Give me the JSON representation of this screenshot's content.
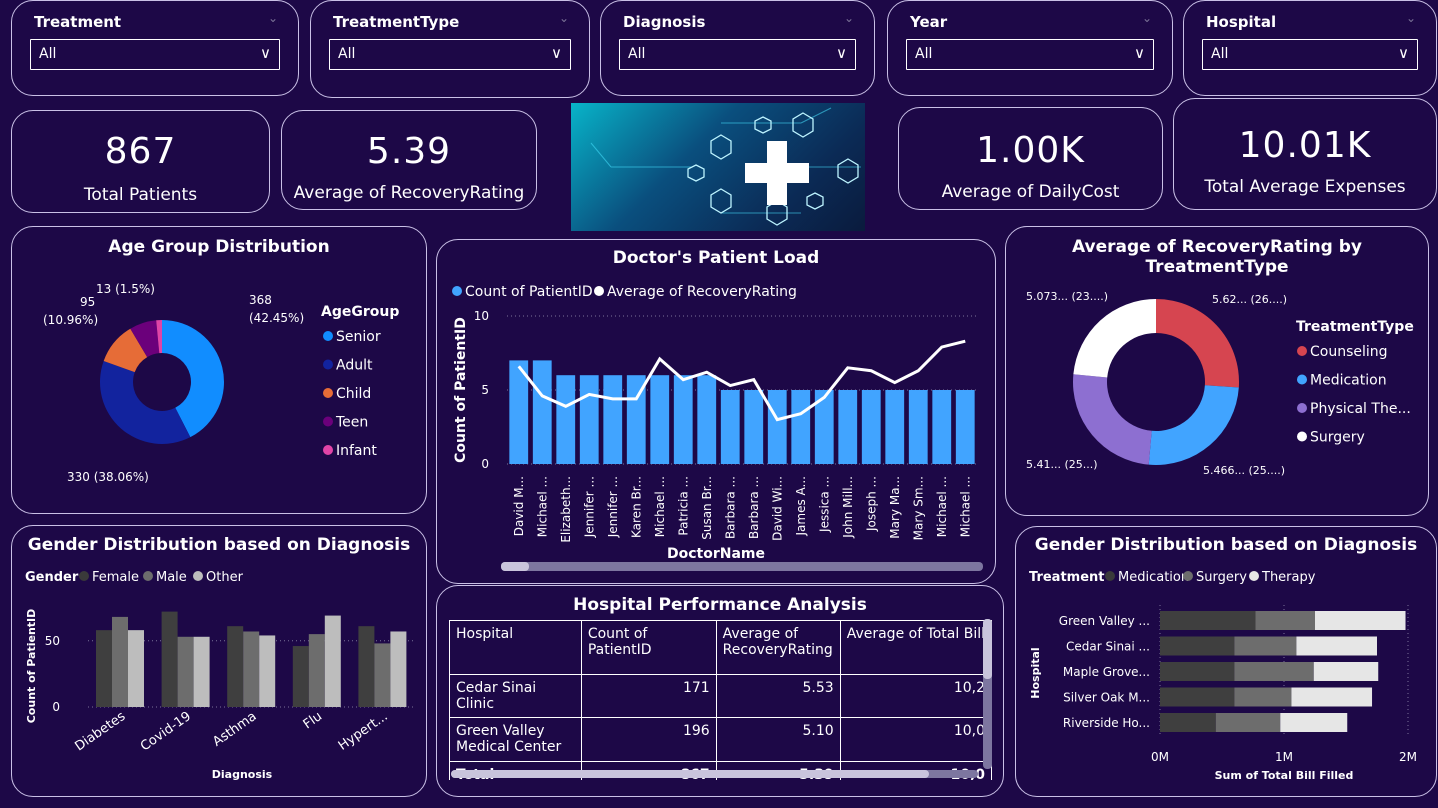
{
  "slicers": [
    {
      "title": "Treatment",
      "value": "All"
    },
    {
      "title": "TreatmentType",
      "value": "All"
    },
    {
      "title": "Diagnosis",
      "value": "All"
    },
    {
      "title": "Year",
      "value": "All"
    },
    {
      "title": "Hospital",
      "value": "All"
    }
  ],
  "kpis": [
    {
      "value": "867",
      "label": "Total Patients"
    },
    {
      "value": "5.39",
      "label": "Average of RecoveryRating"
    },
    {
      "value": "1.00K",
      "label": "Average of DailyCost"
    },
    {
      "value": "10.01K",
      "label": "Total Average Expenses"
    }
  ],
  "age": {
    "title": "Age Group Distribution",
    "legend_title": "AgeGroup",
    "labels": {
      "senior": "368",
      "senior_pct": "(42.45%)",
      "adult": "330 (38.06%)",
      "child": "95",
      "child_pct": "(10.96%)",
      "teen_infant": "13 (1.5%)"
    }
  },
  "doctor": {
    "title": "Doctor's Patient Load",
    "legend1": "Count of PatientID",
    "legend2": "Average of RecoveryRating",
    "ylabel": "Count of PatientID",
    "xlabel": "DoctorName",
    "yticks": [
      "10",
      "5",
      "0"
    ]
  },
  "recovery": {
    "title": "Average of RecoveryRating by TreatmentType",
    "legend_title": "TreatmentType",
    "labels": {
      "counseling": "5.62... (26....)",
      "medication": "5.466... (25....)",
      "physical": "5.41... (25...)",
      "surgery": "5.073... (23....)"
    }
  },
  "gender_left": {
    "title": "Gender Distribution based on Diagnosis",
    "legend_title": "Gender",
    "ylabel": "Count of PatientID",
    "xlabel": "Diagnosis",
    "yticks": [
      "50",
      "0"
    ]
  },
  "hospital": {
    "title": "Hospital Performance Analysis",
    "headers": [
      "Hospital",
      "Count of PatientID",
      "Average of RecoveryRating",
      "Average of Total Bill"
    ],
    "rows": [
      [
        "Cedar Sinai Clinic",
        "171",
        "5.53",
        "10,2"
      ],
      [
        "Green Valley Medical Center",
        "196",
        "5.10",
        "10,0"
      ]
    ],
    "total": [
      "Total",
      "867",
      "5.39",
      "10,0"
    ]
  },
  "gender_right": {
    "title": "Gender Distribution based on Diagnosis",
    "legend_title": "Treatment",
    "ylabel": "Hospital",
    "xlabel": "Sum of Total Bill Filled",
    "xticks": [
      "0M",
      "1M",
      "2M"
    ]
  },
  "chart_data": [
    {
      "type": "pie",
      "title": "Age Group Distribution",
      "categories": [
        "Senior",
        "Adult",
        "Child",
        "Teen",
        "Infant"
      ],
      "values": [
        368,
        330,
        95,
        61,
        13
      ],
      "colors": [
        "#118dff",
        "#12239e",
        "#e66c37",
        "#6b007b",
        "#e044a7"
      ]
    },
    {
      "type": "bar",
      "title": "Doctor's Patient Load",
      "categories": [
        "David M...",
        "Michael ...",
        "Elizabeth...",
        "Jennifer ...",
        "Jennifer ...",
        "Karen Br...",
        "Michael ...",
        "Patricia ...",
        "Susan Br...",
        "Barbara ...",
        "Barbara ...",
        "David Wi...",
        "James A...",
        "Jessica ...",
        "John Mill...",
        "Joseph ...",
        "Mary Ma...",
        "Mary Sm...",
        "Michael ...",
        "Michael ..."
      ],
      "series": [
        {
          "name": "Count of PatientID",
          "values": [
            7,
            7,
            6,
            6,
            6,
            6,
            6,
            6,
            6,
            5,
            5,
            5,
            5,
            5,
            5,
            5,
            5,
            5,
            5,
            5
          ]
        },
        {
          "name": "Average of RecoveryRating",
          "values": [
            6.6,
            4.6,
            3.9,
            4.7,
            4.4,
            4.4,
            7.1,
            5.7,
            6.2,
            5.3,
            5.7,
            3.0,
            3.4,
            4.5,
            6.5,
            6.3,
            5.5,
            6.3,
            7.9,
            8.3
          ]
        }
      ],
      "ylim": [
        0,
        10
      ]
    },
    {
      "type": "pie",
      "title": "Average of RecoveryRating by TreatmentType",
      "categories": [
        "Counseling",
        "Medication",
        "Physical The...",
        "Surgery"
      ],
      "values": [
        5.62,
        5.466,
        5.41,
        5.073
      ],
      "colors": [
        "#d64550",
        "#41a4ff",
        "#8d6fd1",
        "#ffffff"
      ]
    },
    {
      "type": "bar",
      "title": "Gender Distribution based on Diagnosis",
      "categories": [
        "Diabetes",
        "Covid-19",
        "Asthma",
        "Flu",
        "Hypert..."
      ],
      "series": [
        {
          "name": "Female",
          "values": [
            58,
            72,
            61,
            46,
            61
          ]
        },
        {
          "name": "Male",
          "values": [
            68,
            53,
            57,
            55,
            48
          ]
        },
        {
          "name": "Other",
          "values": [
            58,
            53,
            54,
            69,
            57
          ]
        }
      ],
      "ylim": [
        0,
        80
      ]
    },
    {
      "type": "bar",
      "title": "Gender Distribution based on Diagnosis",
      "categories": [
        "Green Valley ...",
        "Cedar Sinai ...",
        "Maple Grove...",
        "Silver Oak M...",
        "Riverside Ho..."
      ],
      "series": [
        {
          "name": "Medication",
          "values": [
            0.77,
            0.6,
            0.6,
            0.6,
            0.45
          ]
        },
        {
          "name": "Surgery",
          "values": [
            0.48,
            0.5,
            0.64,
            0.46,
            0.52
          ]
        },
        {
          "name": "Therapy",
          "values": [
            0.73,
            0.65,
            0.52,
            0.65,
            0.54
          ]
        }
      ],
      "xlim": [
        0,
        2
      ]
    }
  ]
}
